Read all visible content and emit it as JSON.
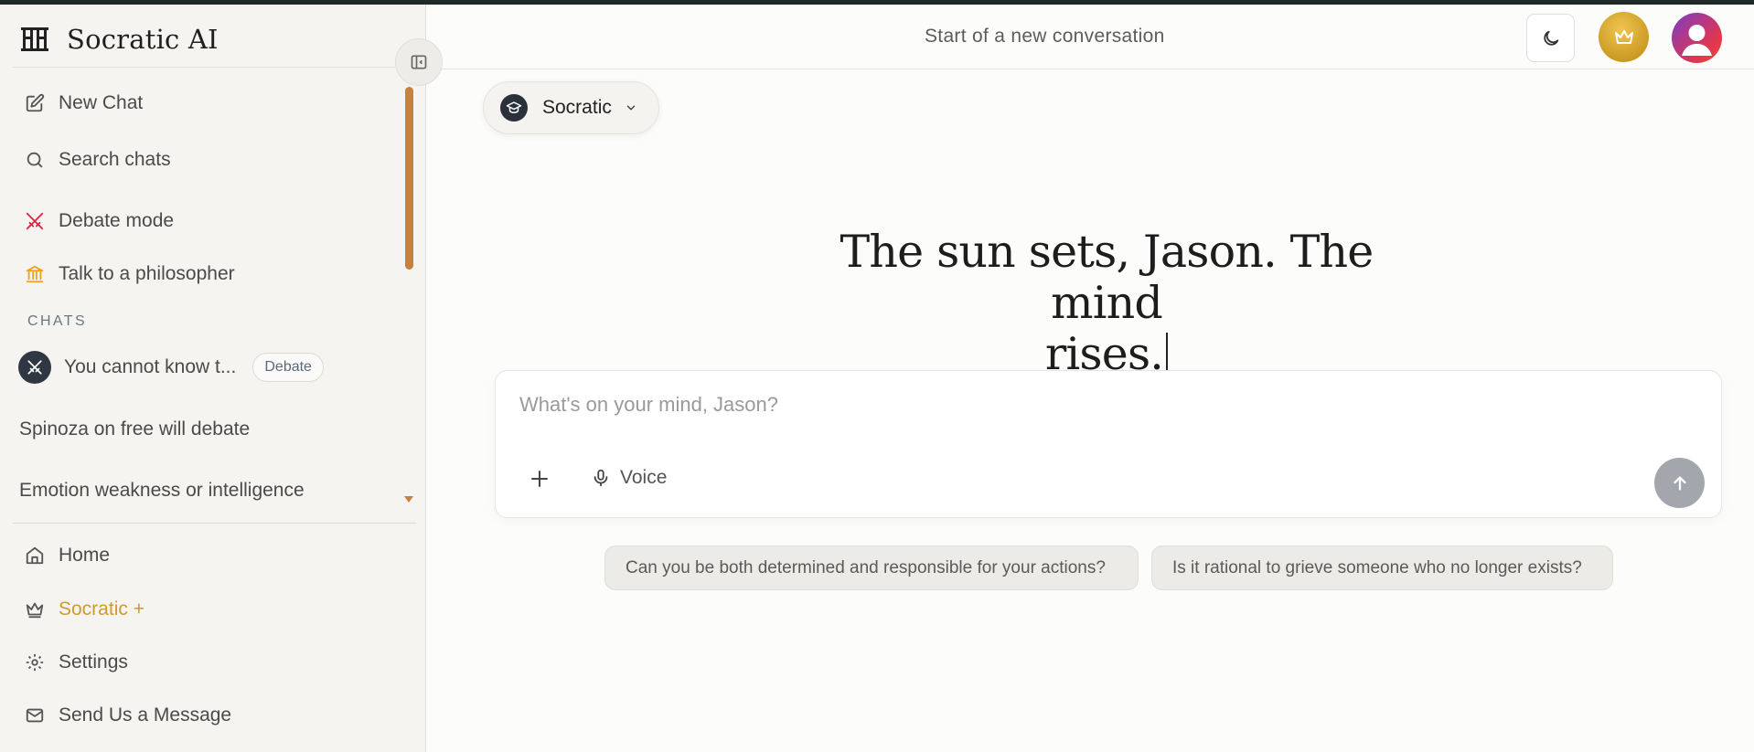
{
  "app": {
    "brand": "Socratic AI"
  },
  "sidebar": {
    "nav": [
      {
        "label": "New Chat",
        "icon": "edit-icon"
      },
      {
        "label": "Search chats",
        "icon": "search-icon"
      },
      {
        "label": "Debate mode",
        "icon": "swords-icon"
      },
      {
        "label": "Talk to a philosopher",
        "icon": "temple-icon"
      }
    ],
    "section_label": "CHATS",
    "chats": [
      {
        "title": "You cannot know t...",
        "badge": "Debate"
      },
      {
        "title": "Spinoza on free will debate"
      },
      {
        "title": "Emotion weakness or intelligence"
      }
    ],
    "bottom_nav": [
      {
        "label": "Home",
        "icon": "home-icon"
      },
      {
        "label": "Socratic +",
        "icon": "crown-icon"
      },
      {
        "label": "Settings",
        "icon": "gear-icon"
      },
      {
        "label": "Send Us a Message",
        "icon": "mail-icon"
      }
    ]
  },
  "header": {
    "title": "Start of a new conversation"
  },
  "model_selector": {
    "label": "Socratic"
  },
  "hero": {
    "greeting_line1": "The sun sets, Jason. The mind",
    "greeting_line2": "rises."
  },
  "composer": {
    "placeholder": "What's on your mind, Jason?",
    "value": "",
    "voice_label": "Voice"
  },
  "suggestions": [
    "Can you be both determined and responsible for your actions?",
    "Is it rational to grieve someone who no longer exists?"
  ],
  "colors": {
    "accent_orange": "#c6813f",
    "plus_gold": "#d19a2a",
    "debate_red": "#e0233f",
    "temple_orange": "#f0a020",
    "send_gray": "#a3a7ad"
  }
}
